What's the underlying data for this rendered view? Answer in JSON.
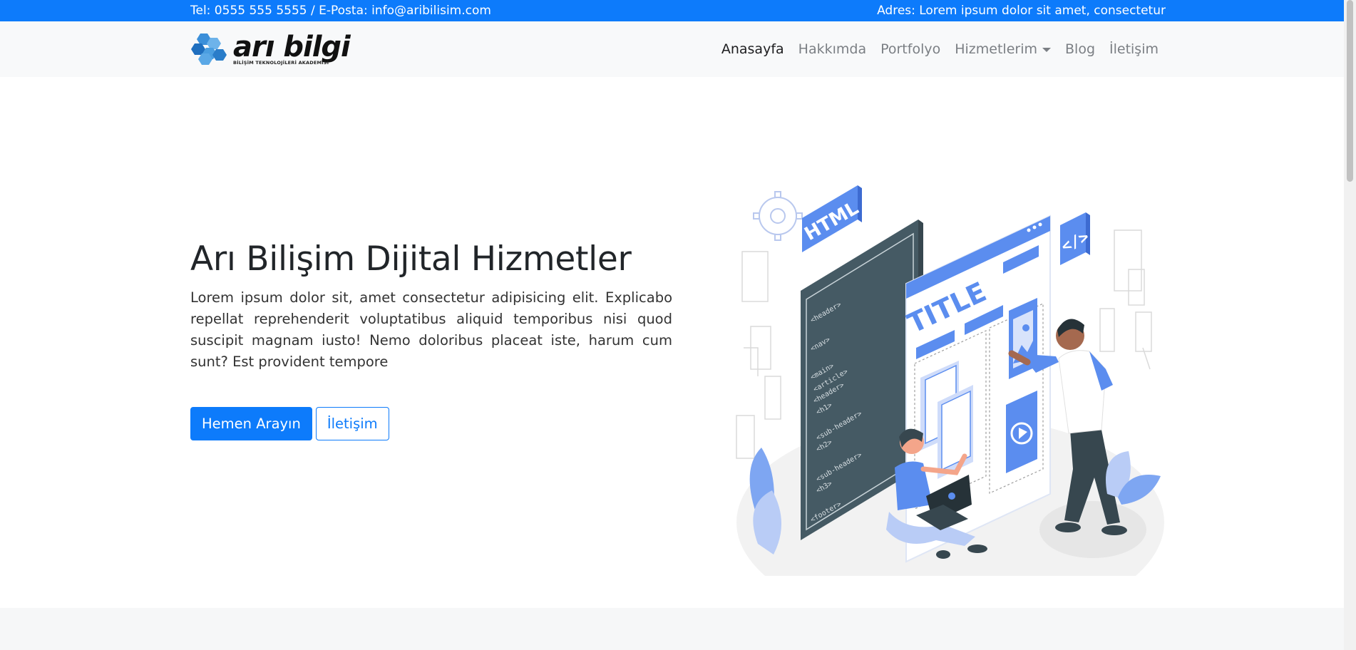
{
  "topbar": {
    "contact": "Tel: 0555 555 5555 / E-Posta: info@aribilisim.com",
    "address": "Adres: Lorem ipsum dolor sit amet, consectetur"
  },
  "brand": {
    "name": "arı bilgi",
    "tagline": "BİLİŞİM TEKNOLOJİLERİ AKADEMİSİ",
    "logo_icon": "honeycomb-icon"
  },
  "nav": {
    "items": [
      {
        "label": "Anasayfa",
        "active": true
      },
      {
        "label": "Hakkımda"
      },
      {
        "label": "Portfolyo"
      },
      {
        "label": "Hizmetlerim",
        "dropdown": true
      },
      {
        "label": "Blog"
      },
      {
        "label": "İletişim"
      }
    ]
  },
  "hero": {
    "title": "Arı Bilişim Dijital Hizmetler",
    "text": "Lorem ipsum dolor sit, amet consectetur adipisicing elit. Explicabo repellat reprehenderit voluptatibus aliquid temporibus nisi quod suscipit magnam iusto! Nemo doloribus placeat iste, harum cum sunt? Est provident tempore",
    "primary_button": "Hemen Arayın",
    "secondary_button": "İletişim"
  },
  "illustration": {
    "html_badge": "HTML",
    "code_badge": "</>",
    "page_title": "TITLE",
    "code_lines": [
      "<header>",
      "<nav>",
      "<main>",
      "<article>",
      "<header>",
      "<h1>",
      "<sub-header>",
      "<h2>",
      "<sub-header>",
      "<h3>",
      "<footer>"
    ],
    "colors": {
      "accent": "#5b8def",
      "dark_panel": "#455a64",
      "primary": "#0d7bfb"
    }
  }
}
